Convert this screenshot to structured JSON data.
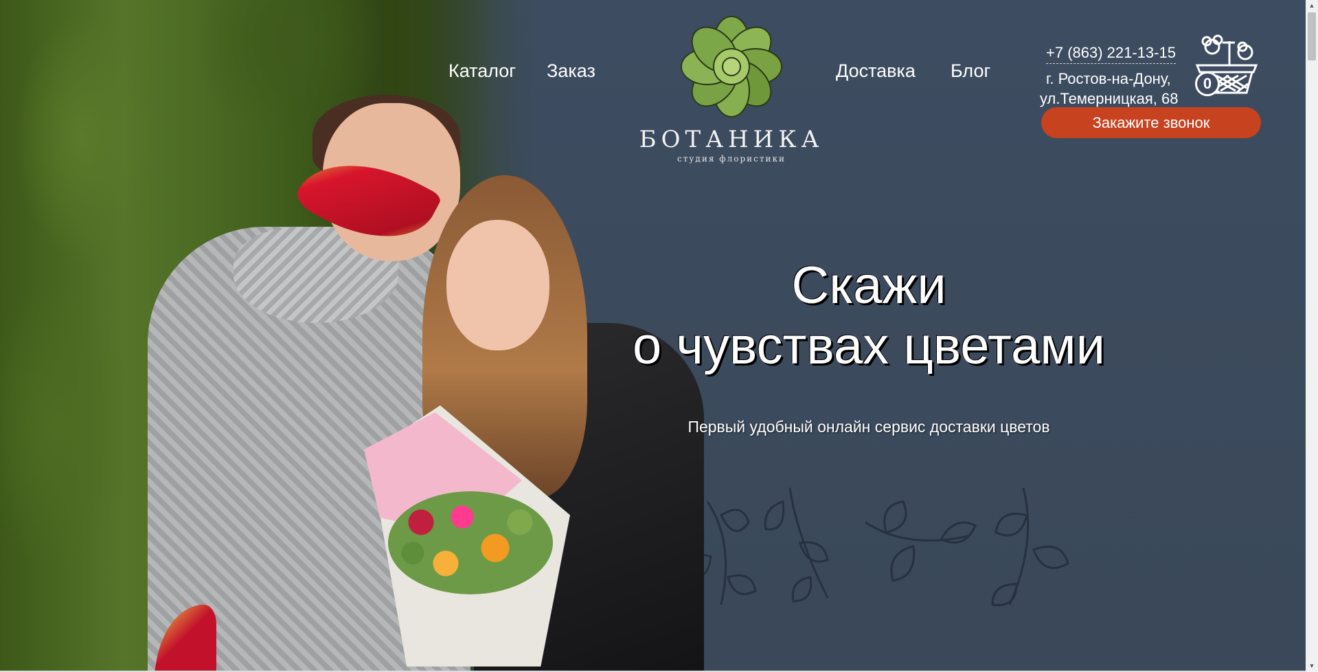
{
  "header": {
    "nav_left": [
      "Каталог",
      "Заказ"
    ],
    "nav_right": [
      "Доставка",
      "Блог"
    ],
    "logo": {
      "title": "БОТАНИКА",
      "subtitle": "студия флористики"
    },
    "contacts": {
      "phone": "+7 (863) 221-13-15",
      "address_line1": "г. Ростов-на-Дону,",
      "address_line2": "ул.Темерницкая, 68"
    },
    "callback_button": "Закажите звонок",
    "cart": {
      "icon": "basket-icon",
      "count": "0"
    }
  },
  "hero": {
    "title_line1": "Скажи",
    "title_line2": "о чувствах цветами",
    "subtitle": "Первый удобный онлайн сервис доставки цветов"
  },
  "colors": {
    "background": "#3d4c60",
    "accent_button": "#c7421f",
    "text": "#ffffff"
  }
}
